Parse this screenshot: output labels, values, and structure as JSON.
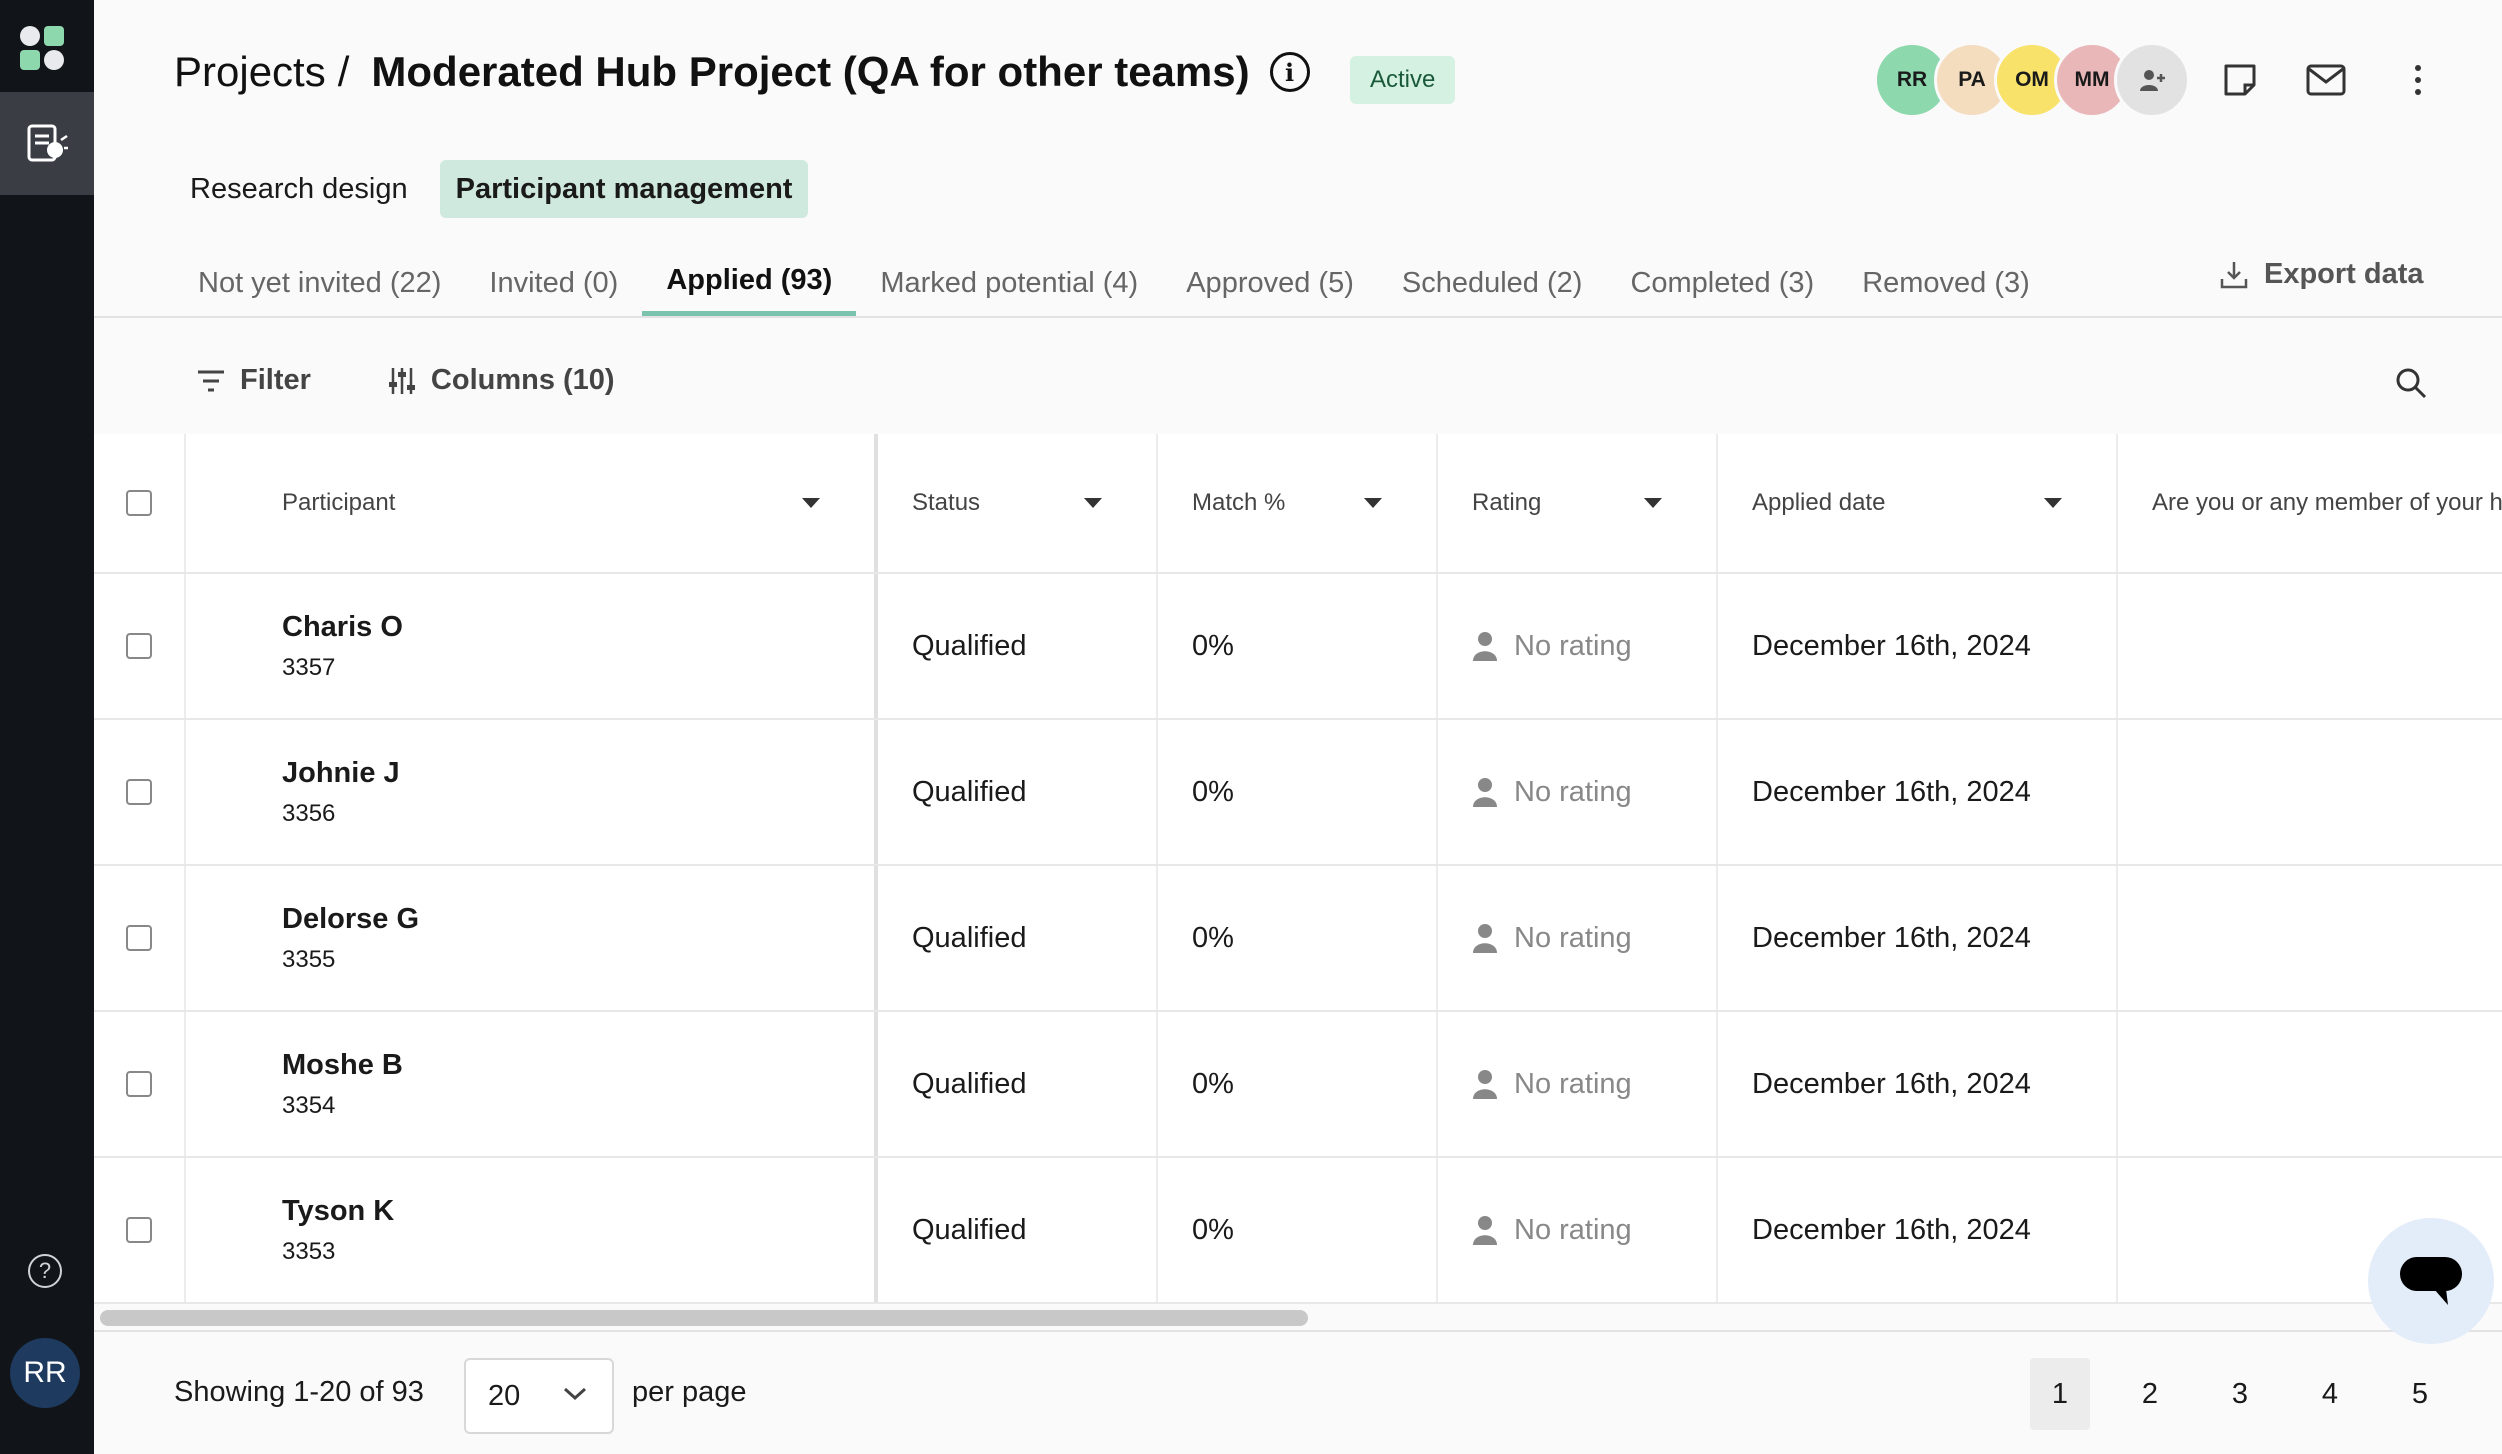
{
  "rail": {
    "user_initials": "RR",
    "help_glyph": "?"
  },
  "header": {
    "breadcrumb_root": "Projects",
    "breadcrumb_sep": "/",
    "project_title": "Moderated Hub Project (QA for other teams)",
    "info_glyph": "i",
    "status_badge": "Active"
  },
  "collaborators": [
    {
      "initials": "RR",
      "color": "#8ed8ae"
    },
    {
      "initials": "PA",
      "color": "#f4dcbf"
    },
    {
      "initials": "OM",
      "color": "#f8e26a"
    },
    {
      "initials": "MM",
      "color": "#eab7b9"
    }
  ],
  "subnav": {
    "research_design": "Research design",
    "participant_management": "Participant management"
  },
  "tabs": [
    "Not yet invited (22)",
    "Invited (0)",
    "Applied (93)",
    "Marked potential (4)",
    "Approved (5)",
    "Scheduled (2)",
    "Completed (3)",
    "Removed (3)"
  ],
  "export_label": "Export data",
  "toolbar": {
    "filter": "Filter",
    "columns": "Columns (10)"
  },
  "columns": {
    "participant": "Participant",
    "status": "Status",
    "match": "Match %",
    "rating": "Rating",
    "applied": "Applied date",
    "question": "Are you or any member of your h..."
  },
  "rows": [
    {
      "name": "Charis O",
      "id": "3357",
      "status": "Qualified",
      "match": "0%",
      "rating": "No rating",
      "applied": "December 16th, 2024"
    },
    {
      "name": "Johnie J",
      "id": "3356",
      "status": "Qualified",
      "match": "0%",
      "rating": "No rating",
      "applied": "December 16th, 2024"
    },
    {
      "name": "Delorse G",
      "id": "3355",
      "status": "Qualified",
      "match": "0%",
      "rating": "No rating",
      "applied": "December 16th, 2024"
    },
    {
      "name": "Moshe B",
      "id": "3354",
      "status": "Qualified",
      "match": "0%",
      "rating": "No rating",
      "applied": "December 16th, 2024"
    },
    {
      "name": "Tyson K",
      "id": "3353",
      "status": "Qualified",
      "match": "0%",
      "rating": "No rating",
      "applied": "December 16th, 2024"
    }
  ],
  "footer": {
    "showing": "Showing 1-20 of 93",
    "per_page_value": "20",
    "per_page_label": "per page",
    "pages": [
      "1",
      "2",
      "3",
      "4",
      "5"
    ]
  }
}
